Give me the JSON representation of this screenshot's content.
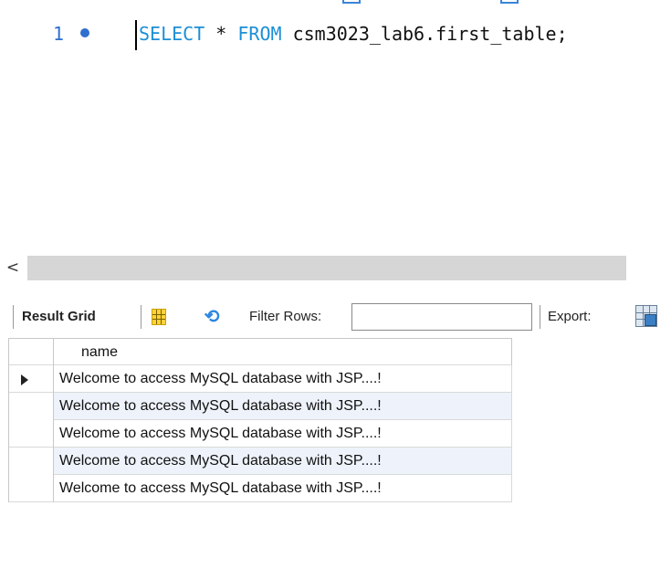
{
  "editor": {
    "line_number": "1",
    "code": {
      "select_kw": "SELECT",
      "star": " * ",
      "from_kw": "FROM",
      "rest": " csm3023_lab6.first_table;"
    }
  },
  "scrollbar": {
    "left_arrow": "<"
  },
  "toolbar": {
    "result_grid_label": "Result Grid",
    "filter_rows_label": "Filter Rows:",
    "filter_rows_value": "",
    "export_label": "Export:"
  },
  "grid": {
    "columns": [
      "name"
    ],
    "rows": [
      "Welcome to access MySQL database with JSP....!",
      "Welcome to access MySQL database with JSP....!",
      "Welcome to access MySQL database with JSP....!",
      "Welcome to access MySQL database with JSP....!",
      "Welcome to access MySQL database with JSP....!"
    ]
  },
  "colors": {
    "keyword": "#1d8fd6",
    "line_number": "#2f6fcf",
    "alt_row": "#eef3fb",
    "scroll_thumb": "#d6d6d6"
  }
}
